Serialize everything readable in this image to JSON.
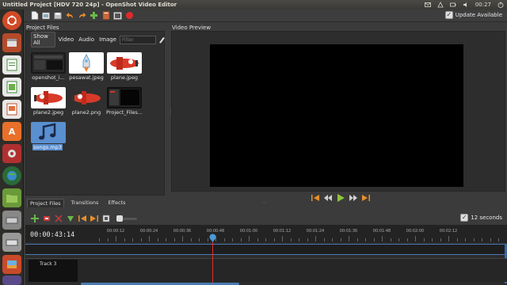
{
  "window_title": "Untitled Project [HDV 720 24p] - OpenShot Video Editor",
  "clock": "00:27",
  "toolbar": {
    "update_label": "Update Available",
    "buttons": [
      "new-project",
      "open-project",
      "save-project",
      "undo",
      "redo",
      "import-files",
      "choose-profile",
      "fullscreen",
      "export-video"
    ]
  },
  "project_files": {
    "title": "Project Files",
    "filters": [
      "Show All",
      "Video",
      "Audio",
      "Image"
    ],
    "filter_placeholder": "Filter",
    "files": [
      {
        "name": "openshot_i..."
      },
      {
        "name": "pesawat.jpeg"
      },
      {
        "name": "plane.jpeg"
      },
      {
        "name": "plane2.jpeg"
      },
      {
        "name": "plane2.png"
      },
      {
        "name": "Project_Files..."
      },
      {
        "name": "songs.mp3"
      }
    ]
  },
  "tabs": [
    "Project Files",
    "Transitions",
    "Effects"
  ],
  "video_preview": {
    "title": "Video Preview"
  },
  "timeline": {
    "current_time": "00:00:43:14",
    "zoom_label": "12 seconds",
    "ticks": [
      "00:00:12",
      "00:00:24",
      "00:00:36",
      "00:00:48",
      "00:01:00",
      "00:01:12",
      "00:01:24",
      "00:01:36",
      "00:01:48",
      "00:02:00",
      "00:02:12"
    ],
    "track_label": "Track 3"
  },
  "colors": {
    "accent": "#5a8fd0",
    "playhead": "#e03030",
    "play_button": "#8ec43a",
    "control_orange": "#e8902a"
  }
}
